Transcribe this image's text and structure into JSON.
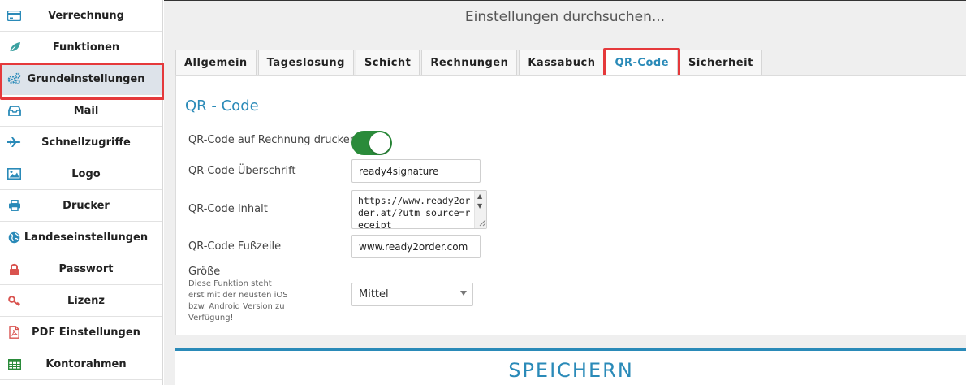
{
  "sidebar": {
    "items": [
      {
        "label": "Verrechnung",
        "icon": "credit-card-icon"
      },
      {
        "label": "Funktionen",
        "icon": "leaf-icon"
      },
      {
        "label": "Grundeinstellungen",
        "icon": "gears-icon"
      },
      {
        "label": "Mail",
        "icon": "inbox-icon"
      },
      {
        "label": "Schnellzugriffe",
        "icon": "plane-icon"
      },
      {
        "label": "Logo",
        "icon": "image-icon"
      },
      {
        "label": "Drucker",
        "icon": "printer-icon"
      },
      {
        "label": "Landeseinstellungen",
        "icon": "globe-icon"
      },
      {
        "label": "Passwort",
        "icon": "lock-icon"
      },
      {
        "label": "Lizenz",
        "icon": "key-icon"
      },
      {
        "label": "PDF Einstellungen",
        "icon": "pdf-file-icon"
      },
      {
        "label": "Kontorahmen",
        "icon": "table-icon"
      }
    ],
    "active_index": 2
  },
  "search": {
    "placeholder": "Einstellungen durchsuchen..."
  },
  "tabs": [
    {
      "label": "Allgemein"
    },
    {
      "label": "Tageslosung"
    },
    {
      "label": "Schicht"
    },
    {
      "label": "Rechnungen"
    },
    {
      "label": "Kassabuch"
    },
    {
      "label": "QR-Code"
    },
    {
      "label": "Sicherheit"
    }
  ],
  "active_tab": "QR-Code",
  "panel": {
    "title": "QR - Code",
    "fields": {
      "print_toggle": {
        "label": "QR-Code auf Rechnung drucken",
        "on": true
      },
      "heading": {
        "label": "QR-Code Überschrift",
        "value": "ready4signature"
      },
      "content": {
        "label": "QR-Code Inhalt",
        "value": "https://www.ready2order.at/?utm_source=receipt"
      },
      "footer": {
        "label": "QR-Code Fußzeile",
        "value": "www.ready2order.com"
      },
      "size": {
        "label": "Größe",
        "help": "Diese Funktion steht erst mit der neusten iOS bzw. Android Version zu Verfügung!",
        "value": "Mittel"
      }
    }
  },
  "save": {
    "label": "SPEICHERN"
  },
  "colors": {
    "accent": "#2a8ab8",
    "toggle_on": "#2a8b3a",
    "highlight": "#e5393b",
    "active_sidebar": "#dde3ea"
  }
}
